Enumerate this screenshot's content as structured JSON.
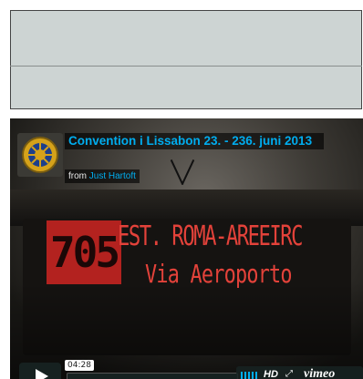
{
  "video": {
    "title": "Convention i Lissabon 23. - 236. juni 2013",
    "byline_prefix": "from",
    "author": "Just Hartoft",
    "current_time": "04:28",
    "hd_label": "HD",
    "brand": "vimeo",
    "frame": {
      "route_number": "705",
      "destination_line1": "EST. ROMA-AREEIRC",
      "destination_line2": "Via Aeroporto"
    }
  },
  "icons": {
    "logo": "rotary-wheel-logo",
    "play": "play-icon",
    "volume": "volume-bars-icon",
    "fullscreen": "fullscreen-icon"
  },
  "colors": {
    "accent": "#00adef",
    "led": "#e3423a",
    "led_box": "#b3221f",
    "placeholder": "#cdd4d3"
  }
}
